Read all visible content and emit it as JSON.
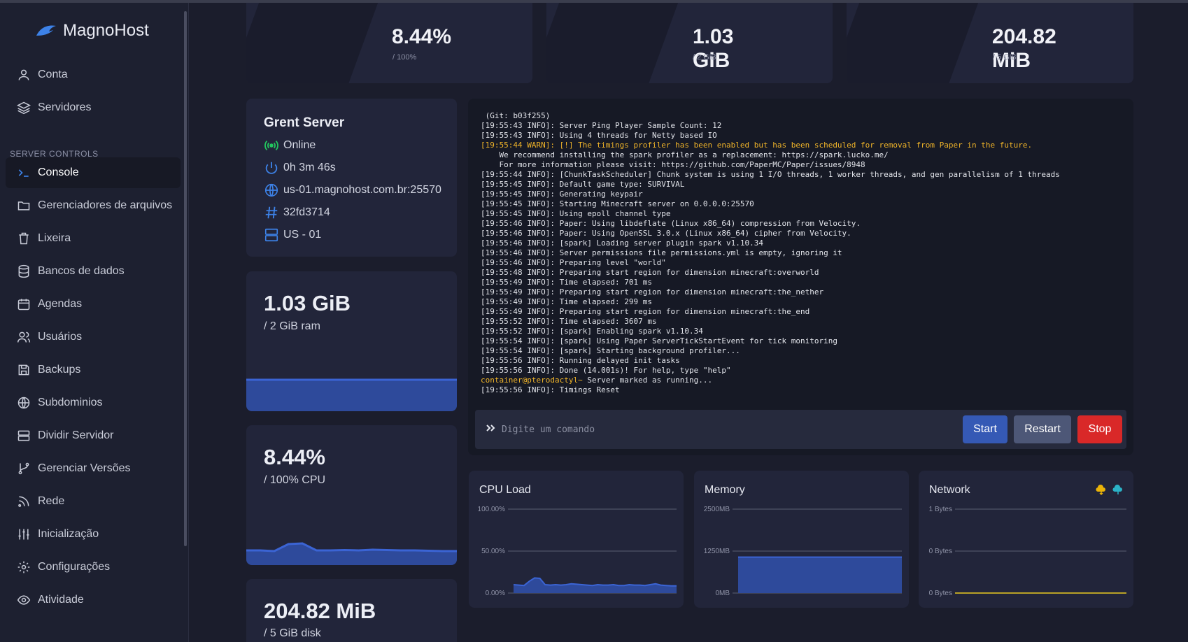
{
  "brand": {
    "name": "MagnoHost"
  },
  "sidebar": {
    "top_items": [
      {
        "label": "Conta",
        "icon": "user-icon"
      },
      {
        "label": "Servidores",
        "icon": "layers-icon"
      }
    ],
    "section_label": "SERVER CONTROLS",
    "items": [
      {
        "label": "Console",
        "icon": "terminal-icon",
        "active": true
      },
      {
        "label": "Gerenciadores de arquivos",
        "icon": "folder-icon"
      },
      {
        "label": "Lixeira",
        "icon": "trash-icon"
      },
      {
        "label": "Bancos de dados",
        "icon": "database-icon"
      },
      {
        "label": "Agendas",
        "icon": "calendar-icon"
      },
      {
        "label": "Usuários",
        "icon": "users-icon"
      },
      {
        "label": "Backups",
        "icon": "save-icon"
      },
      {
        "label": "Subdominios",
        "icon": "globe-icon"
      },
      {
        "label": "Dividir Servidor",
        "icon": "server-icon"
      },
      {
        "label": "Gerenciar Versões",
        "icon": "git-branch-icon"
      },
      {
        "label": "Rede",
        "icon": "rss-icon"
      },
      {
        "label": "Inicialização",
        "icon": "sliders-icon"
      },
      {
        "label": "Configurações",
        "icon": "settings-icon"
      },
      {
        "label": "Atividade",
        "icon": "eye-icon"
      }
    ]
  },
  "top_stats": [
    {
      "value": "8.44%",
      "sub": "/ 100%"
    },
    {
      "value": "1.03 GiB",
      "sub": "/ 2 GiB"
    },
    {
      "value": "204.82 MiB",
      "sub": "/ 5 GiB"
    }
  ],
  "server": {
    "name": "Grent Server",
    "status": "Online",
    "uptime": "0h 3m 46s",
    "address": "us-01.magnohost.com.br:25570",
    "id": "32fd3714",
    "node": "US - 01",
    "status_color": "#22c55e"
  },
  "resources": {
    "ram": {
      "value": "1.03 GiB",
      "sub": "/ 2 GiB ram",
      "fill_fraction": 0.515
    },
    "cpu": {
      "value": "8.44%",
      "sub": "/ 100% CPU"
    },
    "disk": {
      "value": "204.82 MiB",
      "sub": "/ 5 GiB disk"
    }
  },
  "console": {
    "lines": [
      {
        "text": " (Git: b03f255)",
        "type": "info"
      },
      {
        "text": "[19:55:43 INFO]: Server Ping Player Sample Count: 12",
        "type": "info"
      },
      {
        "text": "[19:55:43 INFO]: Using 4 threads for Netty based IO",
        "type": "info"
      },
      {
        "text": "[19:55:44 WARN]: [!] The timings profiler has been enabled but has been scheduled for removal from Paper in the future.",
        "type": "warn"
      },
      {
        "text": "    We recommend installing the spark profiler as a replacement: https://spark.lucko.me/",
        "type": "info"
      },
      {
        "text": "    For more information please visit: https://github.com/PaperMC/Paper/issues/8948",
        "type": "info"
      },
      {
        "text": "[19:55:44 INFO]: [ChunkTaskScheduler] Chunk system is using 1 I/O threads, 1 worker threads, and gen parallelism of 1 threads",
        "type": "info"
      },
      {
        "text": "[19:55:45 INFO]: Default game type: SURVIVAL",
        "type": "info"
      },
      {
        "text": "[19:55:45 INFO]: Generating keypair",
        "type": "info"
      },
      {
        "text": "[19:55:45 INFO]: Starting Minecraft server on 0.0.0.0:25570",
        "type": "info"
      },
      {
        "text": "[19:55:45 INFO]: Using epoll channel type",
        "type": "info"
      },
      {
        "text": "[19:55:46 INFO]: Paper: Using libdeflate (Linux x86_64) compression from Velocity.",
        "type": "info"
      },
      {
        "text": "[19:55:46 INFO]: Paper: Using OpenSSL 3.0.x (Linux x86_64) cipher from Velocity.",
        "type": "info"
      },
      {
        "text": "[19:55:46 INFO]: [spark] Loading server plugin spark v1.10.34",
        "type": "info"
      },
      {
        "text": "[19:55:46 INFO]: Server permissions file permissions.yml is empty, ignoring it",
        "type": "info"
      },
      {
        "text": "[19:55:46 INFO]: Preparing level \"world\"",
        "type": "info"
      },
      {
        "text": "[19:55:48 INFO]: Preparing start region for dimension minecraft:overworld",
        "type": "info"
      },
      {
        "text": "[19:55:49 INFO]: Time elapsed: 701 ms",
        "type": "info"
      },
      {
        "text": "[19:55:49 INFO]: Preparing start region for dimension minecraft:the_nether",
        "type": "info"
      },
      {
        "text": "[19:55:49 INFO]: Time elapsed: 299 ms",
        "type": "info"
      },
      {
        "text": "[19:55:49 INFO]: Preparing start region for dimension minecraft:the_end",
        "type": "info"
      },
      {
        "text": "[19:55:52 INFO]: Time elapsed: 3607 ms",
        "type": "info"
      },
      {
        "text": "[19:55:52 INFO]: [spark] Enabling spark v1.10.34",
        "type": "info"
      },
      {
        "text": "[19:55:54 INFO]: [spark] Using Paper ServerTickStartEvent for tick monitoring",
        "type": "info"
      },
      {
        "text": "[19:55:54 INFO]: [spark] Starting background profiler...",
        "type": "info"
      },
      {
        "text": "[19:55:56 INFO]: Running delayed init tasks",
        "type": "info"
      },
      {
        "text": "[19:55:56 INFO]: Done (14.001s)! For help, type \"help\"",
        "type": "info"
      },
      {
        "prompt": "container@pterodactyl~",
        "text": " Server marked as running...",
        "type": "prompt"
      },
      {
        "text": "[19:55:56 INFO]: Timings Reset",
        "type": "info"
      }
    ],
    "input_placeholder": "Digite um comando",
    "buttons": {
      "start": "Start",
      "restart": "Restart",
      "stop": "Stop"
    },
    "colors": {
      "start": "#3559b5",
      "restart": "#4d5777",
      "stop": "#d92828",
      "warn": "#f0b429"
    }
  },
  "graphs": {
    "cpu": {
      "title": "CPU Load",
      "ticks": [
        "100.00%",
        "50.00%",
        "0.00%"
      ]
    },
    "memory": {
      "title": "Memory",
      "ticks": [
        "2500MB",
        "1250MB",
        "0MB"
      ]
    },
    "network": {
      "title": "Network",
      "ticks": [
        "1 Bytes",
        "0 Bytes",
        "0 Bytes"
      ]
    }
  },
  "chart_data": [
    {
      "type": "area",
      "title": "CPU Load",
      "ylim": [
        0,
        100
      ],
      "yticks": [
        "100.00%",
        "50.00%",
        "0.00%"
      ],
      "series": [
        {
          "values": [
            10,
            9.5,
            9,
            14,
            18,
            17.5,
            10,
            9.5,
            10,
            9.5,
            10,
            11,
            10.5,
            10,
            9.5,
            9,
            10,
            9.5,
            9.5,
            10,
            9,
            9,
            10,
            9.5,
            9.5,
            9,
            10,
            11,
            9.5,
            9,
            8.5,
            8.5
          ]
        }
      ]
    },
    {
      "type": "area",
      "title": "Memory",
      "ylim": [
        0,
        2500
      ],
      "yticks": [
        "2500MB",
        "1250MB",
        "0MB"
      ],
      "series": [
        {
          "values": [
            1070,
            1070,
            1070,
            1070,
            1070,
            1070,
            1070,
            1070
          ]
        }
      ]
    },
    {
      "type": "line",
      "title": "Network",
      "ylim": [
        0,
        1
      ],
      "yticks": [
        "1 Bytes",
        "0 Bytes",
        "0 Bytes"
      ],
      "series": [
        {
          "values": [
            0,
            0,
            0,
            0,
            0,
            0,
            0,
            0
          ],
          "color": "#2bb3c7"
        },
        {
          "values": [
            0,
            0,
            0,
            0,
            0,
            0,
            0,
            0
          ],
          "color": "#eab308"
        }
      ]
    }
  ],
  "sparklines": {
    "ram": [
      52,
      52,
      52,
      52,
      52,
      52,
      52,
      52
    ],
    "cpu": [
      9,
      9,
      8,
      18,
      19,
      9,
      9,
      9.5,
      9,
      10,
      9.5,
      9,
      9,
      8.5,
      8,
      8
    ]
  }
}
